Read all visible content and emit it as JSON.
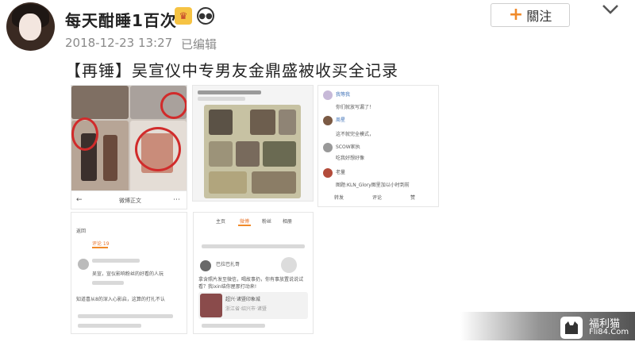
{
  "user": {
    "name": "每天酣睡1百次",
    "badges": [
      "crown-badge-icon",
      "panda-badge-icon"
    ],
    "time": "2018-12-23 13:27",
    "edited": "已编辑"
  },
  "actions": {
    "follow_label": "關注"
  },
  "post": {
    "title": "【再锤】吴宣仪中专男友金鼎盛被收买全记录"
  },
  "shot2": {
    "header": "微博正文"
  },
  "shot4": {
    "back": "返回",
    "tab": "评论 19",
    "comment1": "吴宣，宣仪影响粉丝的好看的人玩",
    "comment2": "知道喜从8的深入心影启，这算的打扎不认"
  },
  "shot5": {
    "tabs": [
      "主页",
      "微博",
      "粉丝",
      "相册"
    ],
    "user": "巴拉巴扎哥",
    "text": "拿含照片发至微信，喝故事扔，你有事放置说说试看？我ixin结你屋那打动来!",
    "link_title": "超兴·诸暨印象城",
    "link_sub": "浙江省·绍兴市·诸暨"
  },
  "shot3": {
    "c1": "你们就放写漏了！",
    "c2": "这不就完全模式，",
    "c3": "SCOW家执",
    "c4": "吃我好想好像",
    "c5": "图题:KLN_Glory图里加以小时到前",
    "actions": [
      "转发",
      "评论",
      "赞"
    ]
  },
  "watermark": {
    "name": "福利猫",
    "url": "Fli84.Com"
  }
}
